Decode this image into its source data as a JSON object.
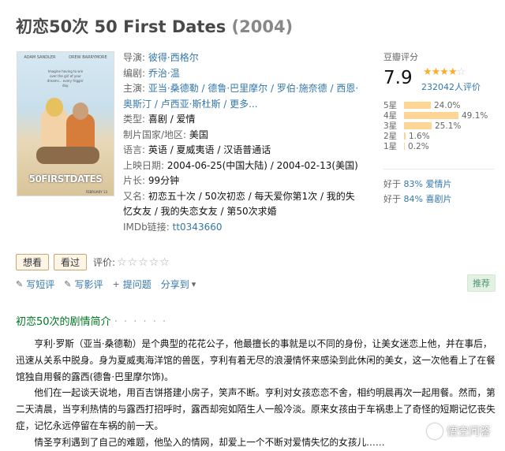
{
  "title": {
    "name": "初恋50次 50 First Dates",
    "year": "(2004)"
  },
  "poster": {
    "actor_left": "ADAM SANDLER",
    "actor_right": "DREW BARRYMORE",
    "tagline": "Imagine having to win over the girl of your dreams... every friggin' day.",
    "title": "50FIRSTDATES",
    "date": "FEBRUARY 13"
  },
  "info": {
    "director_label": "导演:",
    "director": "彼得·西格尔",
    "writer_label": "编剧:",
    "writer": "乔治·温",
    "cast_label": "主演:",
    "cast": "亚当·桑德勒 / 德鲁·巴里摩尔 / 罗伯·施奈德 / 西恩·奥斯汀 / 卢西亚·斯杜斯 / 更多...",
    "genre_label": "类型:",
    "genre": "喜剧 / 爱情",
    "country_label": "制片国家/地区:",
    "country": "美国",
    "language_label": "语言:",
    "language": "英语 / 夏威夷语 / 汉语普通话",
    "release_label": "上映日期:",
    "release": "2004-06-25(中国大陆) / 2004-02-13(美国)",
    "runtime_label": "片长:",
    "runtime": "99分钟",
    "aka_label": "又名:",
    "aka": "初恋五十次 / 50次初恋 / 每天爱你第1次 / 我的失忆女友 / 我的失恋女友 / 第50次求婚",
    "imdb_label": "IMDb链接:",
    "imdb": "tt0343660"
  },
  "rating": {
    "label": "豆瓣评分",
    "score": "7.9",
    "stars_full": "★★★★",
    "stars_empty": "☆",
    "count": "232042人评价",
    "distribution": [
      {
        "label": "5星",
        "percent": 24.0,
        "text": "24.0%"
      },
      {
        "label": "4星",
        "percent": 49.1,
        "text": "49.1%"
      },
      {
        "label": "3星",
        "percent": 25.1,
        "text": "25.1%"
      },
      {
        "label": "2星",
        "percent": 1.6,
        "text": "1.6%"
      },
      {
        "label": "1星",
        "percent": 0.2,
        "text": "0.2%"
      }
    ],
    "better1_pre": "好于",
    "better1_val": "83% 爱情片",
    "better2_pre": "好于",
    "better2_val": "84% 喜剧片"
  },
  "buttons": {
    "want": "想看",
    "seen": "看过",
    "rate_label": "评价:",
    "rate_stars": "☆☆☆☆☆"
  },
  "actions": {
    "short_review": "写短评",
    "review": "写影评",
    "ask": "提问题",
    "share": "分享到",
    "recommend": "推荐"
  },
  "section": {
    "title": "初恋50次的剧情简介",
    "dots": "· · · · · ·"
  },
  "summary": [
    "亨利·罗斯（亚当·桑德勒）是个典型的花花公子，他最擅长的事就是以不同的身份，让美女迷恋上他，并在事后，迅速从关系中脱身。身为夏威夷海洋馆的兽医，亨利有着无尽的浪漫情怀来感染到此休闲的美女，这一次他看上了在餐馆独自用餐的露西(德鲁·巴里摩尔饰)。",
    "他们在一起谈天说地，用百吉饼搭建小房子，笑声不断。亨利对女孩恋恋不舍，相约明晨再次一起用餐。然而，第二天清晨，当亨利热情的与露西打招呼时，露西却宛如陌生人一般冷淡。原来女孩由于车祸患上了奇怪的短期记忆丧失症，记忆永远停留在车祸的前一天。",
    "情圣亨利遇到了自己的难题，他坠入的情网，却爱上一个不断对爱情失忆的女孩儿……"
  ],
  "watermark": "悟空问答"
}
